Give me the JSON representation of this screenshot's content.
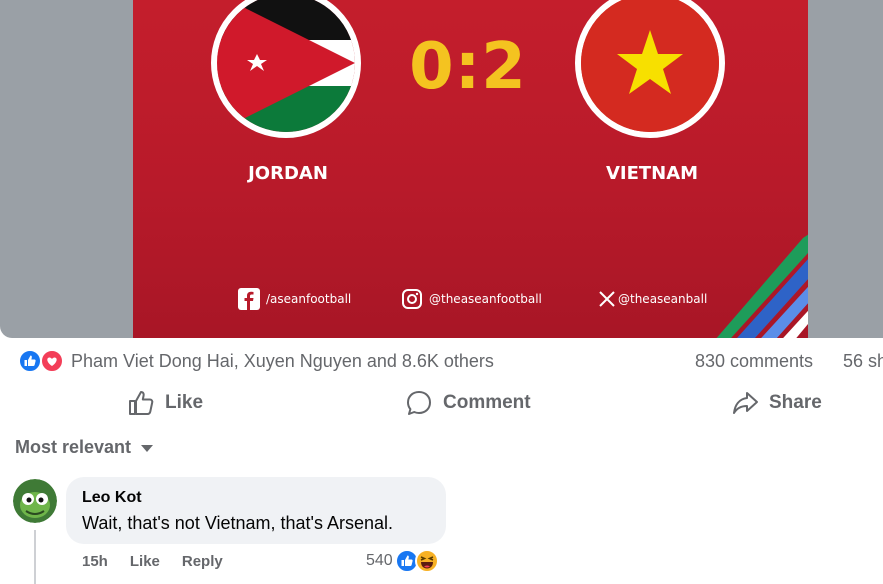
{
  "post_image": {
    "score": "0:2",
    "team_left": "JORDAN",
    "team_right": "VIETNAM",
    "socials": [
      {
        "icon": "facebook-icon",
        "handle": "/aseanfootball"
      },
      {
        "icon": "instagram-icon",
        "handle": "@theaseanfootball"
      },
      {
        "icon": "x-icon",
        "handle": "@theaseanball"
      }
    ],
    "colors": {
      "background": "#c41e2c",
      "score": "#f4c320"
    }
  },
  "reactions": {
    "names": "Pham Viet Dong Hai, Xuyen Nguyen and 8.6K others",
    "comments": "830 comments",
    "shares": "56 sh"
  },
  "actions": {
    "like": "Like",
    "comment": "Comment",
    "share": "Share"
  },
  "sort": {
    "label": "Most relevant"
  },
  "comment": {
    "author": "Leo Kot",
    "text": "Wait, that's not Vietnam, that's Arsenal.",
    "time": "15h",
    "like": "Like",
    "reply": "Reply",
    "reaction_count": "540"
  },
  "colors": {
    "like_blue": "#1877f2",
    "love_red": "#f33e58",
    "muted_text": "#65676b",
    "bubble_bg": "#f0f2f5"
  }
}
